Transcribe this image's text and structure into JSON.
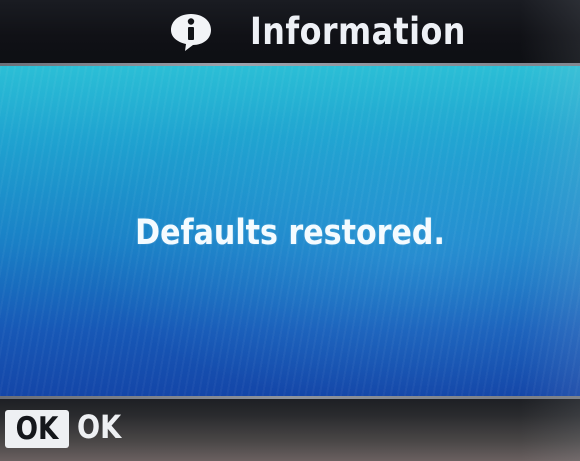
{
  "header": {
    "icon": "info-icon",
    "title": "Information"
  },
  "message": {
    "text": "Defaults restored."
  },
  "footer": {
    "ok_key_label": "OK",
    "ok_action_label": "OK"
  },
  "colors": {
    "content_top": "#2bbfd6",
    "content_bottom": "#1446a8",
    "bar_background": "#101116",
    "text": "#eef1f6"
  }
}
